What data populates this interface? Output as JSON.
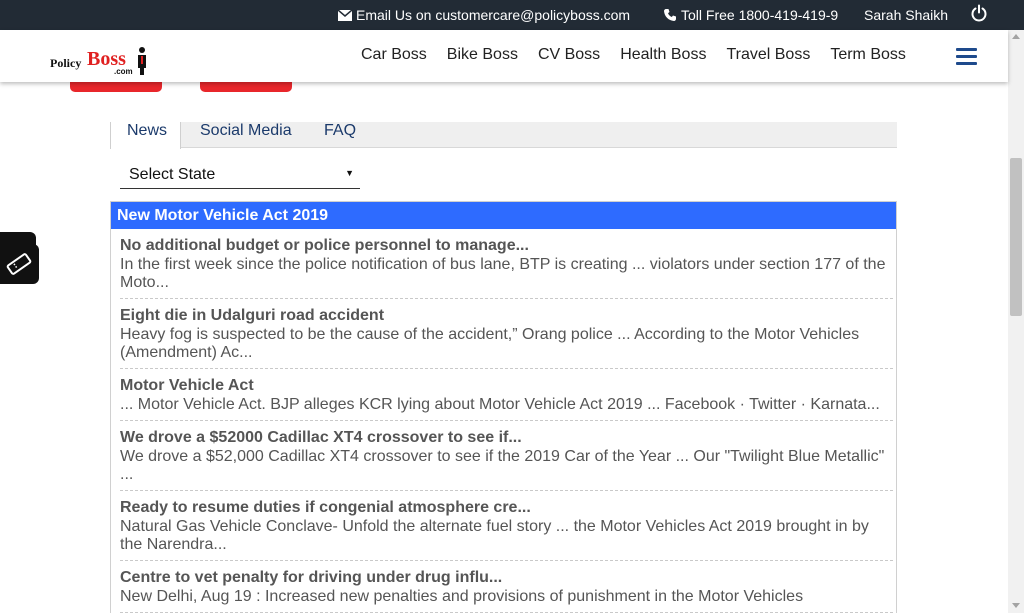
{
  "topbar": {
    "email": "Email Us on customercare@policyboss.com",
    "phone": "Toll Free 1800-419-419-9",
    "user": "Sarah Shaikh"
  },
  "logo": {
    "policy": "Policy",
    "boss": "Boss",
    "com": ".com"
  },
  "nav": [
    "Car Boss",
    "Bike Boss",
    "CV Boss",
    "Health Boss",
    "Travel Boss",
    "Term Boss"
  ],
  "tabs": [
    "News",
    "Social Media",
    "FAQ"
  ],
  "state_select": {
    "value": "Select State"
  },
  "news": {
    "heading": "New Motor Vehicle Act 2019",
    "items": [
      {
        "title": "No additional budget or police personnel to manage...",
        "desc": "In the first week since the police notification of bus lane, BTP is creating ... violators under section 177 of the Moto..."
      },
      {
        "title": "Eight die in Udalguri road accident",
        "desc": "Heavy fog is suspected to be the cause of the accident,” Orang police ... According to the Motor Vehicles (Amendment) Ac..."
      },
      {
        "title": "Motor Vehicle Act",
        "desc": "... Motor Vehicle Act. BJP alleges KCR lying about Motor Vehicle Act 2019 ... Facebook · Twitter · Karnata..."
      },
      {
        "title": "We drove a $52000 Cadillac XT4 crossover to see if...",
        "desc": "We drove a $52,000 Cadillac XT4 crossover to see if the 2019 Car of the Year ... Our \"Twilight Blue Metallic\" ..."
      },
      {
        "title": "Ready to resume duties if congenial atmosphere cre...",
        "desc": "Natural Gas Vehicle Conclave- Unfold the alternate fuel story ... the Motor Vehicles Act 2019 brought in by the Narendra..."
      },
      {
        "title": "Centre to vet penalty for driving under drug influ...",
        "desc": "New Delhi, Aug 19 : Increased new penalties and provisions of punishment in the Motor Vehicles"
      }
    ]
  },
  "colors": {
    "topbar": "#222b35",
    "accent_blue": "#2e6bff",
    "brand_red": "#e8262b",
    "nav_blue": "#1e4a8c"
  }
}
